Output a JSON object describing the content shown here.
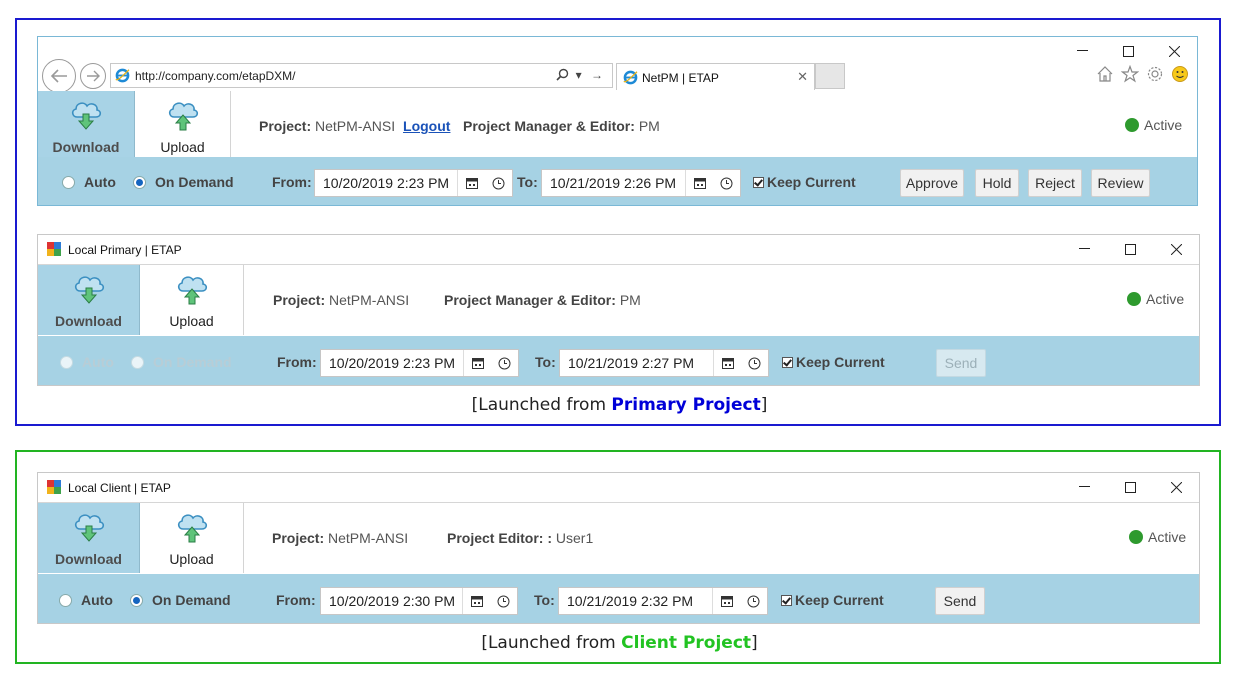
{
  "colors": {
    "primary_frame": "#1a1ad0",
    "client_frame": "#22b422",
    "toolbar_bg": "#a6d2e4",
    "download_tile_bg": "#a8d3e6",
    "active_dot": "#2e9a2e",
    "radio_selected": "#1565c0"
  },
  "browser": {
    "address_url": "http://company.com/etapDXM/",
    "tab_title": "NetPM | ETAP",
    "ribbon": {
      "download": "Download",
      "upload": "Upload"
    },
    "project_label": "Project:",
    "project_value": "NetPM-ANSI",
    "logout": "Logout",
    "role_label": "Project Manager & Editor:",
    "role_value": "PM",
    "status": "Active",
    "toolbar": {
      "auto": "Auto",
      "on_demand": "On Demand",
      "mode_selected": "On Demand",
      "from_label": "From:",
      "from_value": "10/20/2019 2:23 PM",
      "to_label": "To:",
      "to_value": "10/21/2019 2:26 PM",
      "keep_current": "Keep Current",
      "keep_current_checked": true,
      "approve": "Approve",
      "hold": "Hold",
      "reject": "Reject",
      "review": "Review"
    }
  },
  "primary": {
    "title": "Local Primary | ETAP",
    "ribbon": {
      "download": "Download",
      "upload": "Upload"
    },
    "project_label": "Project:",
    "project_value": "NetPM-ANSI",
    "role_label": "Project Manager & Editor:",
    "role_value": "PM",
    "status": "Active",
    "toolbar": {
      "auto": "Auto",
      "on_demand": "On Demand",
      "mode_selected": "",
      "from_label": "From:",
      "from_value": "10/20/2019 2:23 PM",
      "to_label": "To:",
      "to_value": "10/21/2019 2:27 PM",
      "keep_current": "Keep Current",
      "keep_current_checked": true,
      "send": "Send",
      "send_enabled": false
    },
    "caption_prefix": "[Launched from ",
    "caption_highlight": "Primary Project",
    "caption_suffix": "]"
  },
  "client": {
    "title": "Local Client | ETAP",
    "ribbon": {
      "download": "Download",
      "upload": "Upload"
    },
    "project_label": "Project:",
    "project_value": "NetPM-ANSI",
    "role_label": "Project Editor: :",
    "role_value": "User1",
    "status": "Active",
    "toolbar": {
      "auto": "Auto",
      "on_demand": "On Demand",
      "mode_selected": "On Demand",
      "from_label": "From:",
      "from_value": "10/20/2019 2:30 PM",
      "to_label": "To:",
      "to_value": "10/21/2019 2:32 PM",
      "keep_current": "Keep Current",
      "keep_current_checked": true,
      "send": "Send",
      "send_enabled": true
    },
    "caption_prefix": "[Launched from ",
    "caption_highlight": "Client Project",
    "caption_suffix": "]"
  }
}
